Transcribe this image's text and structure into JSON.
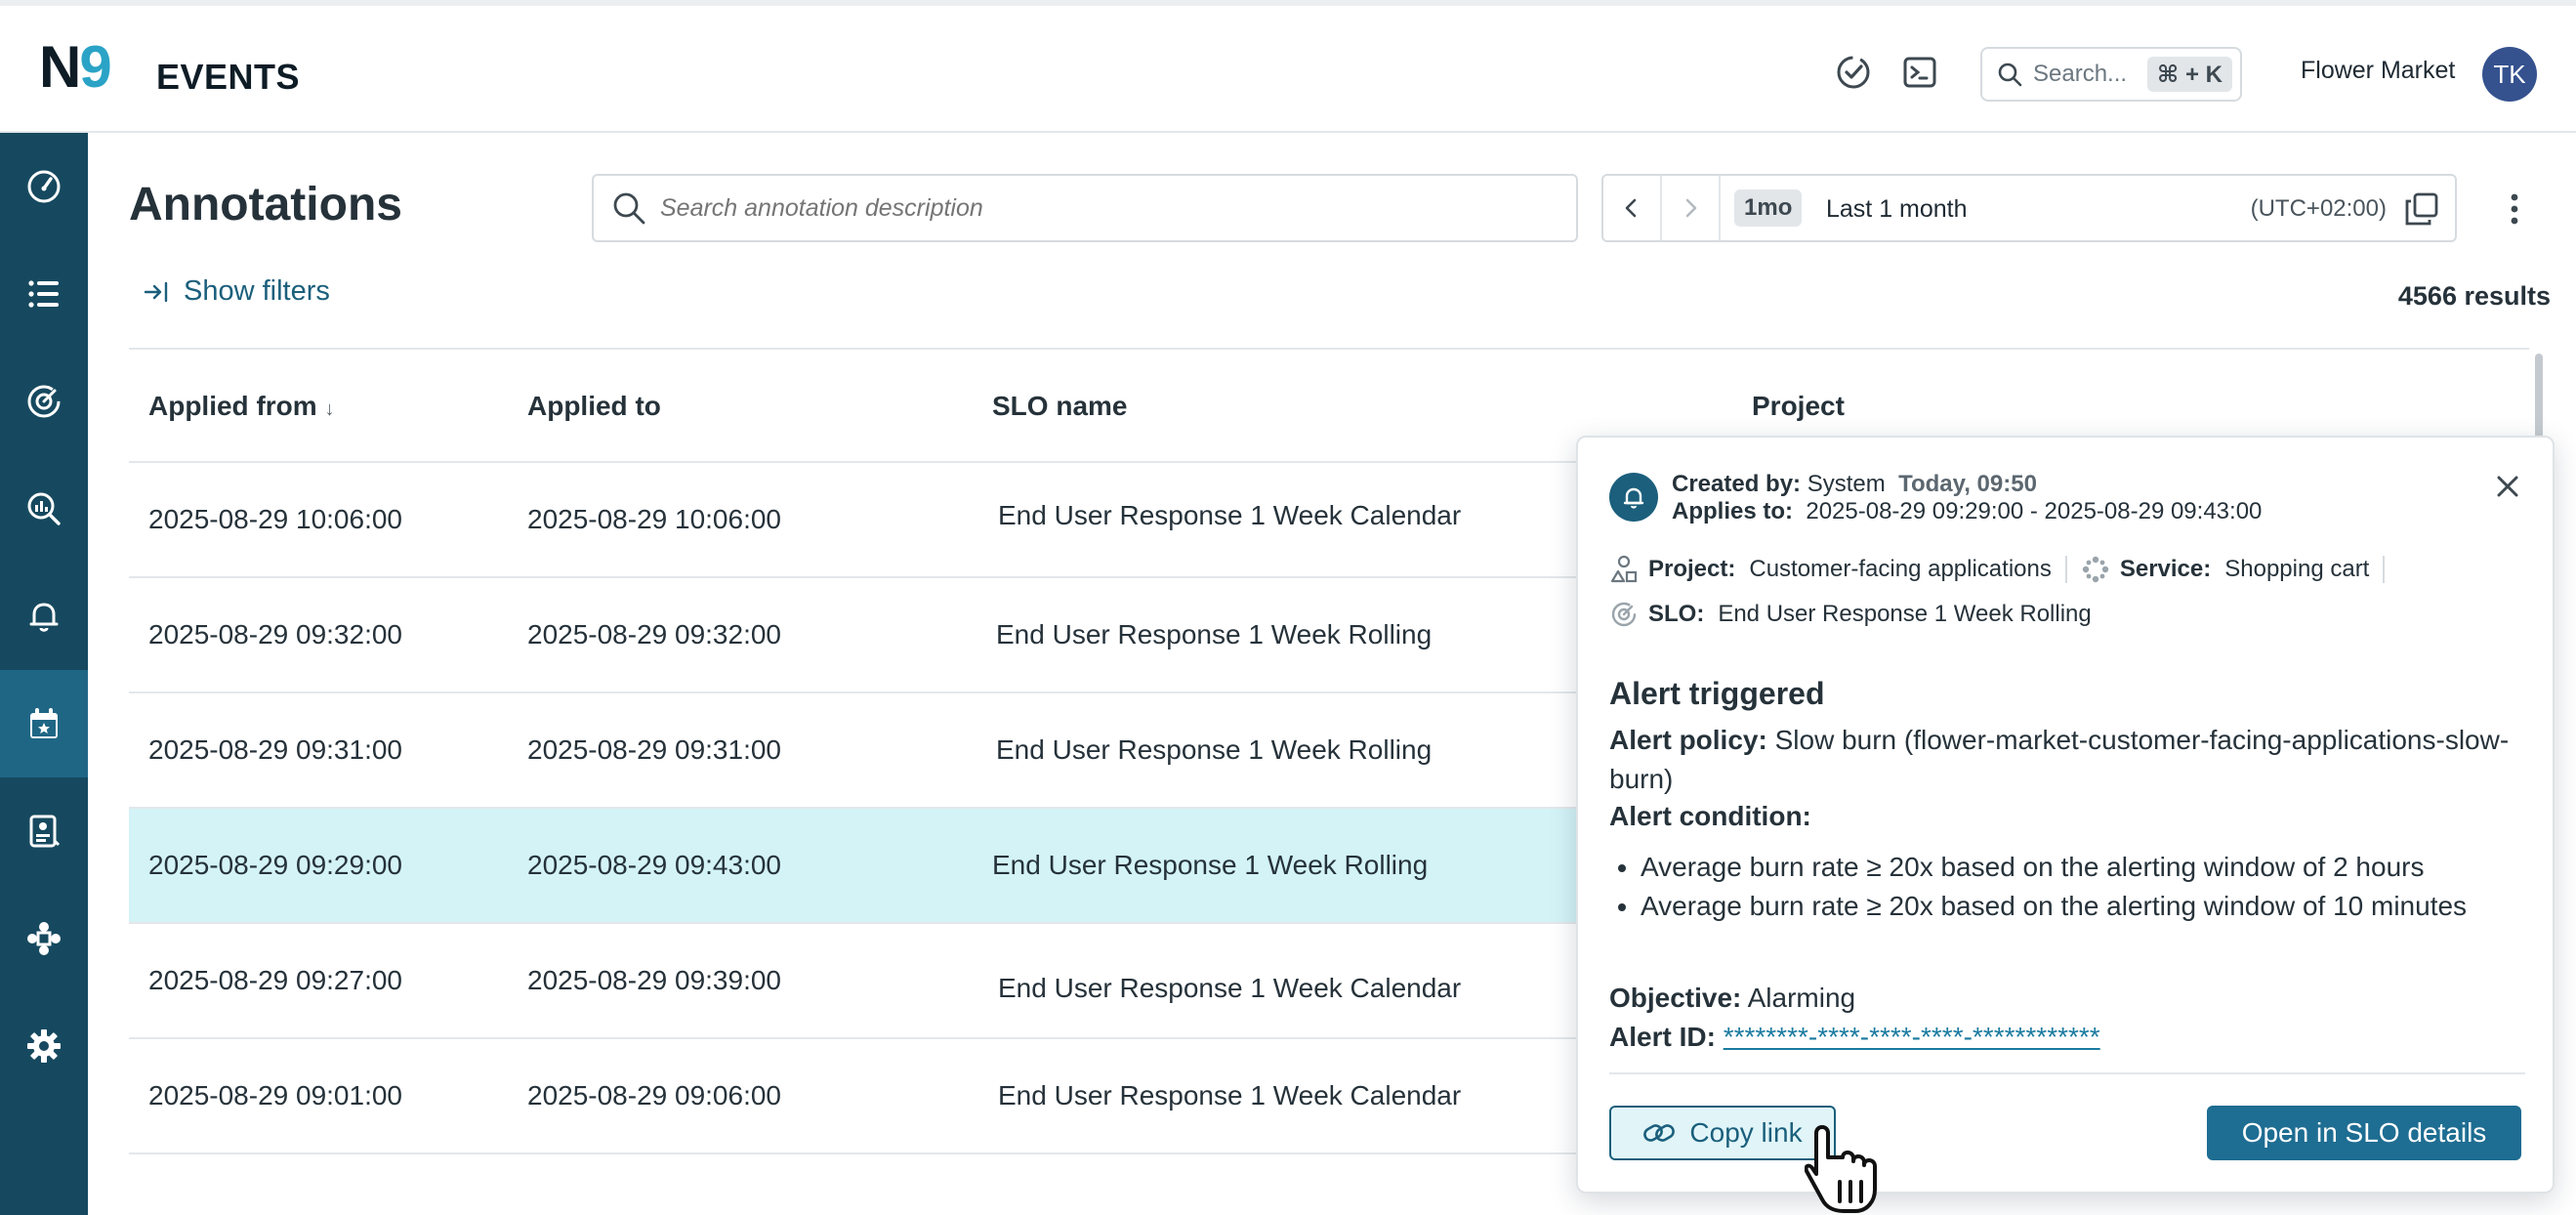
{
  "app": {
    "logo_n": "N",
    "logo_9": "9",
    "name": "EVENTS"
  },
  "topbar": {
    "search_placeholder": "Search...",
    "search_shortcut": "⌘ + K",
    "org_name": "Flower Market",
    "avatar_initials": "TK"
  },
  "sidebar": {
    "items": [
      {
        "icon": "dashboard-gauge-icon"
      },
      {
        "icon": "list-icon"
      },
      {
        "icon": "slo-target-icon"
      },
      {
        "icon": "analysis-search-icon"
      },
      {
        "icon": "bell-icon"
      },
      {
        "icon": "calendar-icon",
        "active": true
      },
      {
        "icon": "report-icon"
      },
      {
        "icon": "services-cluster-icon"
      },
      {
        "icon": "gear-icon"
      }
    ]
  },
  "page": {
    "title": "Annotations",
    "search_placeholder": "Search annotation description",
    "show_filters": "Show filters",
    "results": "4566 results"
  },
  "date_picker": {
    "chip": "1mo",
    "range": "Last 1 month",
    "timezone": "(UTC+02:00)"
  },
  "table": {
    "headers": {
      "applied_from": "Applied from",
      "applied_from_sort": "↓",
      "applied_to": "Applied to",
      "slo_name": "SLO name",
      "project": "Project"
    },
    "rows": [
      {
        "from": "2025-08-29 10:06:00",
        "to": "2025-08-29 10:06:00",
        "slo": "End User Response 1 Week Calendar"
      },
      {
        "from": "2025-08-29 09:32:00",
        "to": "2025-08-29 09:32:00",
        "slo": "End User Response 1 Week Rolling"
      },
      {
        "from": "2025-08-29 09:31:00",
        "to": "2025-08-29 09:31:00",
        "slo": "End User Response 1 Week Rolling"
      },
      {
        "from": "2025-08-29 09:29:00",
        "to": "2025-08-29 09:43:00",
        "slo": "End User Response 1 Week Rolling",
        "selected": true
      },
      {
        "from": "2025-08-29 09:27:00",
        "to": "2025-08-29 09:39:00",
        "slo": "End User Response 1 Week Calendar"
      },
      {
        "from": "2025-08-29 09:01:00",
        "to": "2025-08-29 09:06:00",
        "slo": "End User Response 1 Week Calendar"
      }
    ]
  },
  "popover": {
    "created_by_label": "Created by:",
    "created_by": "System",
    "created_time": "Today, 09:50",
    "applies_to_label": "Applies to:",
    "applies_to": "2025-08-29 09:29:00 - 2025-08-29 09:43:00",
    "project_label": "Project:",
    "project": "Customer-facing applications",
    "service_label": "Service:",
    "service": "Shopping cart",
    "slo_label": "SLO:",
    "slo": "End User Response 1 Week Rolling",
    "heading": "Alert triggered",
    "alert_policy_label": "Alert policy:",
    "alert_policy": "Slow burn (flower-market-customer-facing-applications-slow-burn)",
    "alert_condition_label": "Alert condition:",
    "conditions": [
      "Average burn rate ≥ 20x based on the alerting window of 2 hours",
      "Average burn rate ≥ 20x based on the alerting window of 10 minutes"
    ],
    "objective_label": "Objective:",
    "objective": "Alarming",
    "alert_id_label": "Alert ID:",
    "alert_id": "********-****-****-****-************",
    "copy_link": "Copy link",
    "open_details": "Open in SLO details"
  }
}
